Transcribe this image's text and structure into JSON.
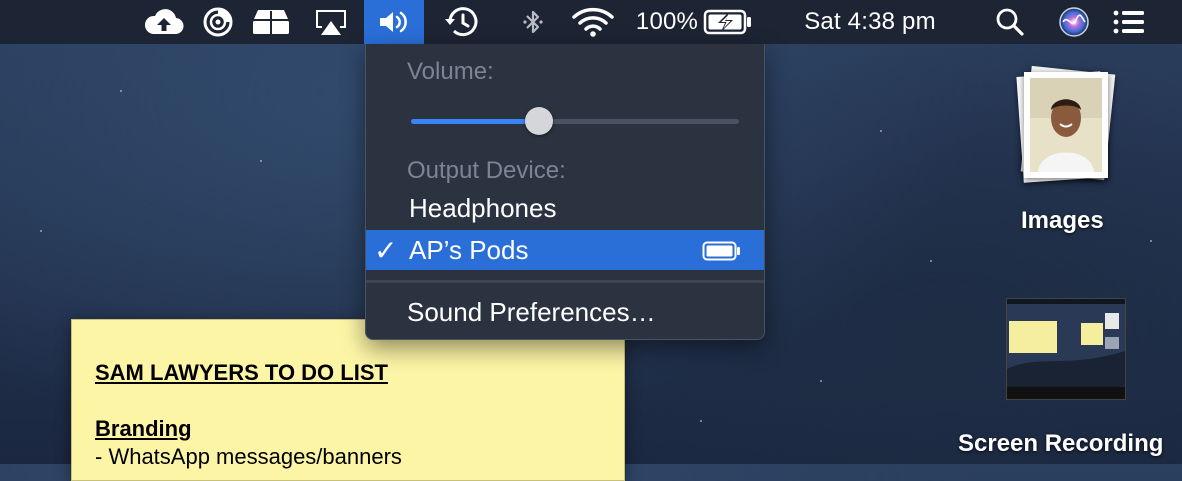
{
  "menubar": {
    "battery_percent": "100%",
    "clock": "Sat 4:38 pm",
    "icons": [
      "cloud-upload-icon",
      "activity-disc-icon",
      "storage-drive-icon",
      "airplay-icon",
      "volume-icon",
      "time-machine-icon",
      "bluetooth-icon",
      "wifi-icon",
      "battery-charging-icon",
      "spotlight-search-icon",
      "siri-icon",
      "notification-center-icon"
    ]
  },
  "volume_menu": {
    "volume_header": "Volume:",
    "volume_level": 0.39,
    "output_header": "Output Device:",
    "devices": [
      {
        "label": "Headphones",
        "selected": false
      },
      {
        "label": "AP’s Pods",
        "selected": true,
        "check": "✓"
      }
    ],
    "preferences_label": "Sound Preferences…"
  },
  "desktop": {
    "images_label": "Images",
    "recording_label": "Screen Recording"
  },
  "sticky_note": {
    "title": "SAM LAWYERS TO DO LIST",
    "section": "Branding",
    "line1": "- WhatsApp messages/banners"
  }
}
